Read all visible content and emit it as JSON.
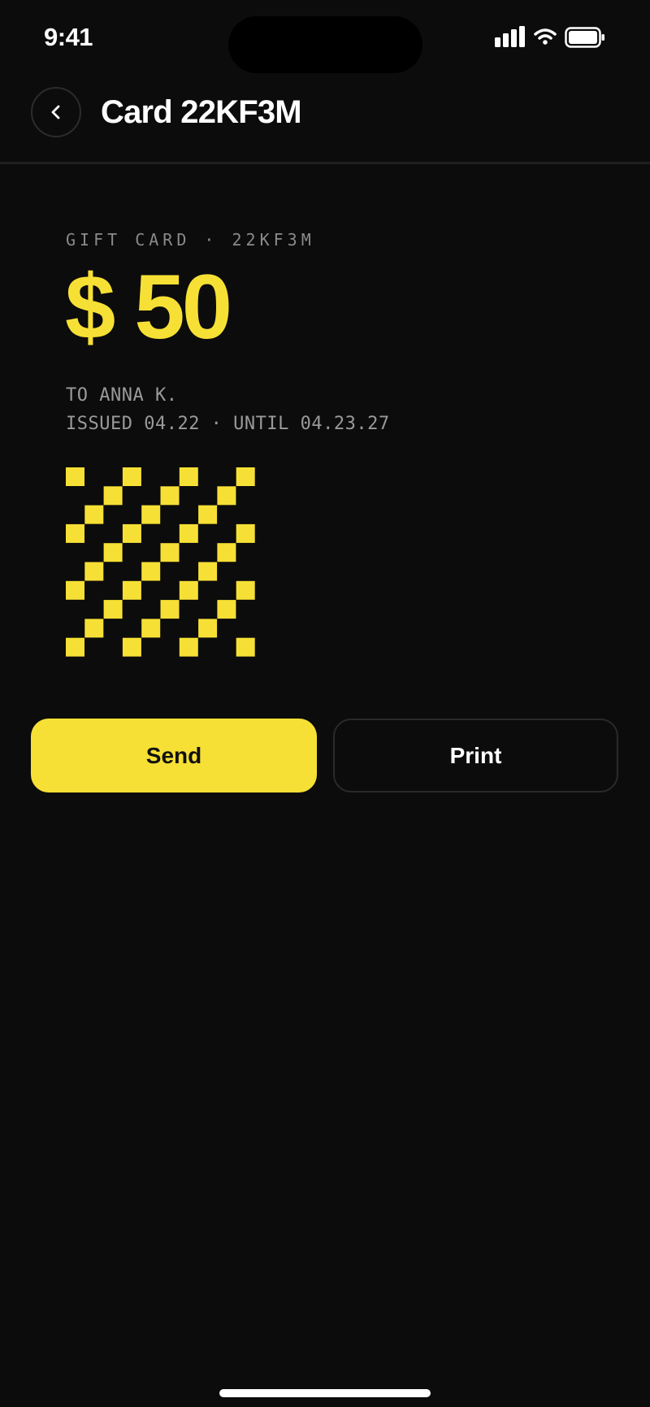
{
  "status_bar": {
    "time": "9:41",
    "icons": [
      "signal-icon",
      "wifi-icon",
      "battery-icon"
    ]
  },
  "header": {
    "back_icon": "chevron-left-icon",
    "title": "Card 22KF3M"
  },
  "card": {
    "label": "GIFT CARD · 22KF3M",
    "amount": "$ 50",
    "recipient": "TO ANNA K.",
    "validity": "ISSUED 04.22 · UNTIL 04.23.27",
    "code_icon": "card-code-pattern"
  },
  "actions": {
    "send_label": "Send",
    "print_label": "Print"
  },
  "colors": {
    "background": "#0c0c0c",
    "accent": "#f7e035",
    "muted_text": "#8a8a8a"
  }
}
